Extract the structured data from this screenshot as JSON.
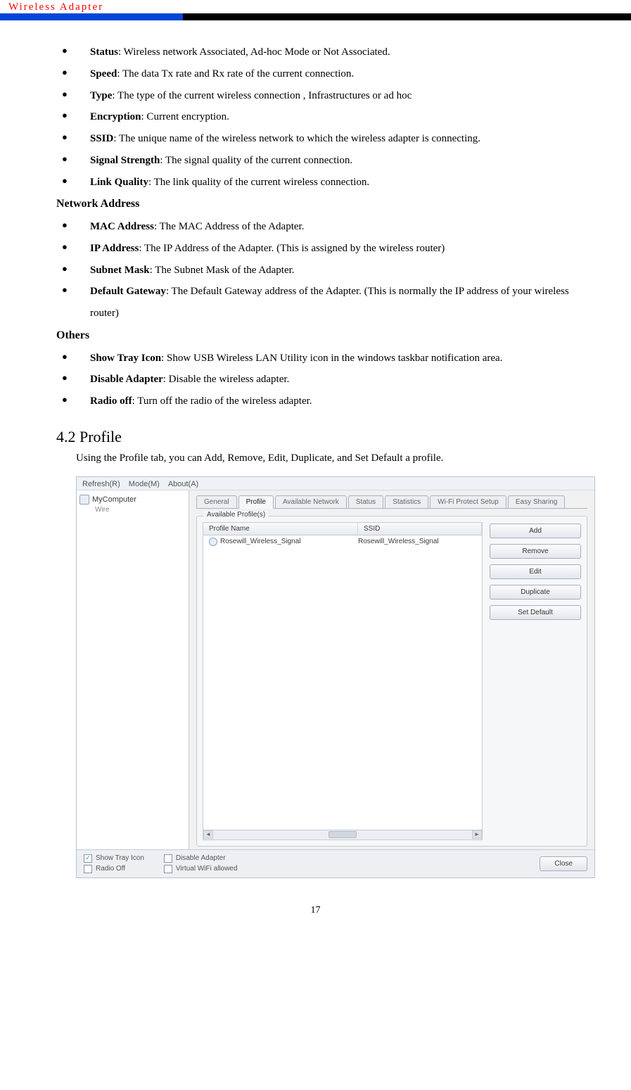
{
  "header_title": "Wireless Adapter",
  "bullets1": [
    {
      "term": "Status",
      "desc": ": Wireless network Associated, Ad-hoc Mode or Not Associated."
    },
    {
      "term": "Speed",
      "desc": ": The data Tx rate and Rx rate of the current connection."
    },
    {
      "term": "Type",
      "desc": ": The type of the current wireless connection , Infrastructures or ad hoc"
    },
    {
      "term": "Encryption",
      "desc": ": Current encryption."
    },
    {
      "term": "SSID",
      "desc": ": The unique name of the wireless network to which the wireless adapter is connecting."
    },
    {
      "term": "Signal Strength",
      "desc": ": The signal quality of the current connection."
    },
    {
      "term": "Link Quality",
      "desc": ": The link quality of the current wireless connection."
    }
  ],
  "section_network": "Network Address",
  "bullets2": [
    {
      "term": "MAC Address",
      "desc": ": The MAC Address of the Adapter."
    },
    {
      "term": "IP Address",
      "desc": ": The IP Address of the Adapter. (This is assigned by the wireless router)"
    },
    {
      "term": "Subnet Mask",
      "desc": ": The Subnet Mask of the Adapter."
    },
    {
      "term": "Default Gateway",
      "desc": ": The Default Gateway address of the Adapter. (This is normally the IP address of your wireless router)"
    }
  ],
  "section_others": "Others",
  "bullets3": [
    {
      "term": "Show Tray Icon",
      "desc": ": Show USB Wireless LAN Utility icon in the windows taskbar notification area."
    },
    {
      "term": "Disable Adapter",
      "desc": ": Disable the wireless adapter."
    },
    {
      "term": "Radio off",
      "desc": ": Turn off the radio of the wireless adapter."
    }
  ],
  "sec42": {
    "heading": "4.2    Profile",
    "desc": "Using the Profile tab, you can Add, Remove, Edit, Duplicate, and Set Default a profile."
  },
  "figure": {
    "menu": [
      "Refresh(R)",
      "Mode(M)",
      "About(A)"
    ],
    "tree_root": "MyComputer",
    "tree_sub": "Wire",
    "tabs": [
      "General",
      "Profile",
      "Available Network",
      "Status",
      "Statistics",
      "Wi-Fi Protect Setup",
      "Easy Sharing"
    ],
    "active_tab_index": 1,
    "group_label": "Available Profile(s)",
    "col_name": "Profile Name",
    "col_ssid": "SSID",
    "row": {
      "name": "Rosewill_Wireless_Signal",
      "ssid": "Rosewill_Wireless_Signal"
    },
    "buttons": [
      "Add",
      "Remove",
      "Edit",
      "Duplicate",
      "Set Default"
    ],
    "checks_left": [
      {
        "label": "Show Tray Icon",
        "checked": true
      },
      {
        "label": "Radio Off",
        "checked": false
      }
    ],
    "checks_mid": [
      {
        "label": "Disable Adapter",
        "checked": false
      },
      {
        "label": "Virtual WiFi allowed",
        "checked": false
      }
    ],
    "close": "Close"
  },
  "page_number": "17"
}
